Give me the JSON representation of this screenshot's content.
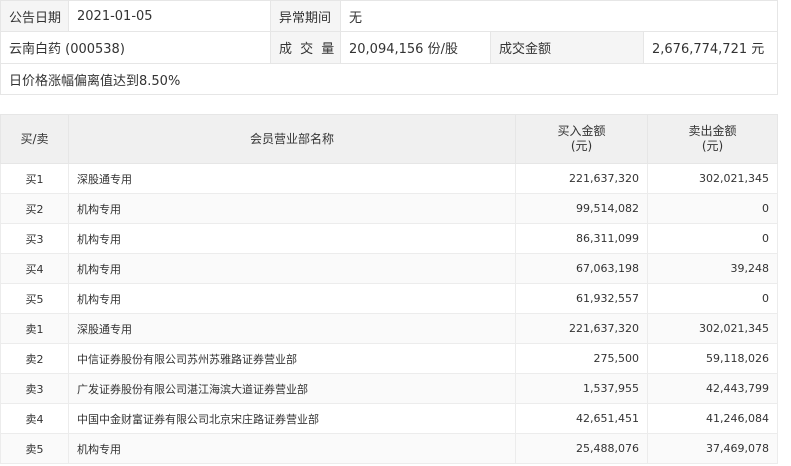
{
  "announcement": {
    "date_label": "公告日期",
    "date_value": "2021-01-05",
    "period_label": "异常期间",
    "period_value": "无",
    "stock_name": "云南白药 (000538)",
    "volume_label": "成 交 量",
    "volume_value": "20,094,156 份/股",
    "amount_label": "成交金额",
    "amount_value": "2,676,774,721 元",
    "reason": "日价格涨幅偏离值达到8.50%"
  },
  "table": {
    "headers": {
      "side": "买/卖",
      "branch": "会员营业部名称",
      "buy_line1": "买入金额",
      "buy_line2": "(元)",
      "sell_line1": "卖出金额",
      "sell_line2": "(元)"
    },
    "rows": [
      {
        "side": "买1",
        "branch": "深股通专用",
        "buy": "221,637,320",
        "sell": "302,021,345"
      },
      {
        "side": "买2",
        "branch": "机构专用",
        "buy": "99,514,082",
        "sell": "0"
      },
      {
        "side": "买3",
        "branch": "机构专用",
        "buy": "86,311,099",
        "sell": "0"
      },
      {
        "side": "买4",
        "branch": "机构专用",
        "buy": "67,063,198",
        "sell": "39,248"
      },
      {
        "side": "买5",
        "branch": "机构专用",
        "buy": "61,932,557",
        "sell": "0"
      },
      {
        "side": "卖1",
        "branch": "深股通专用",
        "buy": "221,637,320",
        "sell": "302,021,345"
      },
      {
        "side": "卖2",
        "branch": "中信证券股份有限公司苏州苏雅路证券营业部",
        "buy": "275,500",
        "sell": "59,118,026"
      },
      {
        "side": "卖3",
        "branch": "广发证券股份有限公司湛江海滨大道证券营业部",
        "buy": "1,537,955",
        "sell": "42,443,799"
      },
      {
        "side": "卖4",
        "branch": "中国中金财富证券有限公司北京宋庄路证券营业部",
        "buy": "42,651,451",
        "sell": "41,246,084"
      },
      {
        "side": "卖5",
        "branch": "机构专用",
        "buy": "25,488,076",
        "sell": "37,469,078"
      }
    ]
  }
}
